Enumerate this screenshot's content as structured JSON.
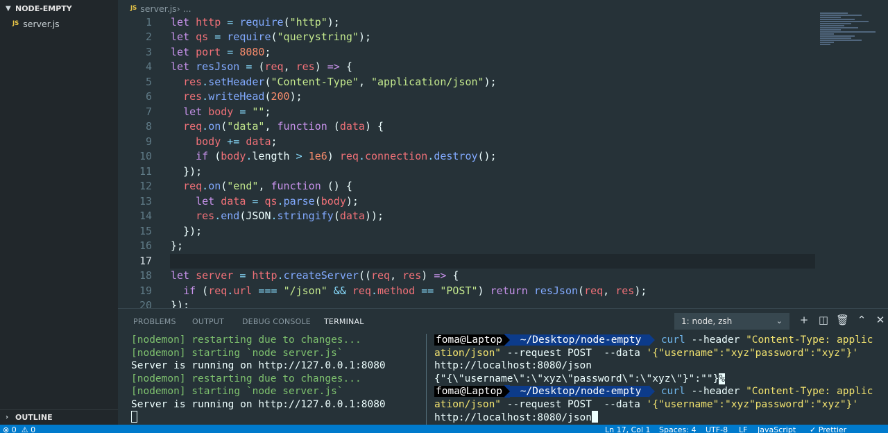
{
  "sidebar": {
    "explorer_title": "NODE-EMPTY",
    "file_badge": "JS",
    "file_name": "server.js",
    "outline_title": "OUTLINE"
  },
  "editor": {
    "breadcrumb_badge": "JS",
    "breadcrumb_file": "server.js",
    "breadcrumb_rest": " › ...",
    "current_line": 17,
    "lines": [
      {
        "n": "1",
        "tokens": [
          [
            "kw",
            "let "
          ],
          [
            "vr",
            "http"
          ],
          [
            "op",
            " = "
          ],
          [
            "fn",
            "require"
          ],
          [
            "pl",
            "("
          ],
          [
            "str",
            "\"http\""
          ],
          [
            "pl",
            ");"
          ]
        ]
      },
      {
        "n": "2",
        "tokens": [
          [
            "kw",
            "let "
          ],
          [
            "vr",
            "qs"
          ],
          [
            "op",
            " = "
          ],
          [
            "fn",
            "require"
          ],
          [
            "pl",
            "("
          ],
          [
            "str",
            "\"querystring\""
          ],
          [
            "pl",
            ");"
          ]
        ]
      },
      {
        "n": "3",
        "tokens": [
          [
            "kw",
            "let "
          ],
          [
            "vr",
            "port"
          ],
          [
            "op",
            " = "
          ],
          [
            "num",
            "8080"
          ],
          [
            "pl",
            ";"
          ]
        ]
      },
      {
        "n": "4",
        "tokens": [
          [
            "kw",
            "let "
          ],
          [
            "fn",
            "resJson"
          ],
          [
            "op",
            " = "
          ],
          [
            "pl",
            "("
          ],
          [
            "vr",
            "req"
          ],
          [
            "pl",
            ", "
          ],
          [
            "vr",
            "res"
          ],
          [
            "pl",
            ") "
          ],
          [
            "kw",
            "=>"
          ],
          [
            "pl",
            " {"
          ]
        ]
      },
      {
        "n": "5",
        "tokens": [
          [
            "pl",
            "  "
          ],
          [
            "vr",
            "res"
          ],
          [
            "op",
            "."
          ],
          [
            "fn",
            "setHeader"
          ],
          [
            "pl",
            "("
          ],
          [
            "str",
            "\"Content-Type\""
          ],
          [
            "pl",
            ", "
          ],
          [
            "str",
            "\"application/json\""
          ],
          [
            "pl",
            ");"
          ]
        ]
      },
      {
        "n": "6",
        "tokens": [
          [
            "pl",
            "  "
          ],
          [
            "vr",
            "res"
          ],
          [
            "op",
            "."
          ],
          [
            "fn",
            "writeHead"
          ],
          [
            "pl",
            "("
          ],
          [
            "num",
            "200"
          ],
          [
            "pl",
            ");"
          ]
        ]
      },
      {
        "n": "7",
        "tokens": [
          [
            "pl",
            "  "
          ],
          [
            "kw",
            "let "
          ],
          [
            "vr",
            "body"
          ],
          [
            "op",
            " = "
          ],
          [
            "str",
            "\"\""
          ],
          [
            "pl",
            ";"
          ]
        ]
      },
      {
        "n": "8",
        "tokens": [
          [
            "pl",
            "  "
          ],
          [
            "vr",
            "req"
          ],
          [
            "op",
            "."
          ],
          [
            "fn",
            "on"
          ],
          [
            "pl",
            "("
          ],
          [
            "str",
            "\"data\""
          ],
          [
            "pl",
            ", "
          ],
          [
            "kw",
            "function"
          ],
          [
            "pl",
            " ("
          ],
          [
            "vr",
            "data"
          ],
          [
            "pl",
            ") {"
          ]
        ]
      },
      {
        "n": "9",
        "tokens": [
          [
            "pl",
            "    "
          ],
          [
            "vr",
            "body"
          ],
          [
            "op",
            " += "
          ],
          [
            "vr",
            "data"
          ],
          [
            "pl",
            ";"
          ]
        ]
      },
      {
        "n": "10",
        "tokens": [
          [
            "pl",
            "    "
          ],
          [
            "kw",
            "if"
          ],
          [
            "pl",
            " ("
          ],
          [
            "vr",
            "body"
          ],
          [
            "op",
            "."
          ],
          [
            "pl",
            "length "
          ],
          [
            "op",
            ">"
          ],
          [
            "pl",
            " "
          ],
          [
            "num",
            "1e6"
          ],
          [
            "pl",
            ") "
          ],
          [
            "vr",
            "req"
          ],
          [
            "op",
            "."
          ],
          [
            "vr",
            "connection"
          ],
          [
            "op",
            "."
          ],
          [
            "fn",
            "destroy"
          ],
          [
            "pl",
            "();"
          ]
        ]
      },
      {
        "n": "11",
        "tokens": [
          [
            "pl",
            "  });"
          ]
        ]
      },
      {
        "n": "12",
        "tokens": [
          [
            "pl",
            "  "
          ],
          [
            "vr",
            "req"
          ],
          [
            "op",
            "."
          ],
          [
            "fn",
            "on"
          ],
          [
            "pl",
            "("
          ],
          [
            "str",
            "\"end\""
          ],
          [
            "pl",
            ", "
          ],
          [
            "kw",
            "function"
          ],
          [
            "pl",
            " () {"
          ]
        ]
      },
      {
        "n": "13",
        "tokens": [
          [
            "pl",
            "    "
          ],
          [
            "kw",
            "let "
          ],
          [
            "vr",
            "data"
          ],
          [
            "op",
            " = "
          ],
          [
            "vr",
            "qs"
          ],
          [
            "op",
            "."
          ],
          [
            "fn",
            "parse"
          ],
          [
            "pl",
            "("
          ],
          [
            "vr",
            "body"
          ],
          [
            "pl",
            ");"
          ]
        ]
      },
      {
        "n": "14",
        "tokens": [
          [
            "pl",
            "    "
          ],
          [
            "vr",
            "res"
          ],
          [
            "op",
            "."
          ],
          [
            "fn",
            "end"
          ],
          [
            "pl",
            "(JSON"
          ],
          [
            "op",
            "."
          ],
          [
            "fn",
            "stringify"
          ],
          [
            "pl",
            "("
          ],
          [
            "vr",
            "data"
          ],
          [
            "pl",
            "));"
          ]
        ]
      },
      {
        "n": "15",
        "tokens": [
          [
            "pl",
            "  });"
          ]
        ]
      },
      {
        "n": "16",
        "tokens": [
          [
            "pl",
            "};"
          ]
        ]
      },
      {
        "n": "17",
        "tokens": []
      },
      {
        "n": "18",
        "tokens": [
          [
            "kw",
            "let "
          ],
          [
            "vr",
            "server"
          ],
          [
            "op",
            " = "
          ],
          [
            "vr",
            "http"
          ],
          [
            "op",
            "."
          ],
          [
            "fn",
            "createServer"
          ],
          [
            "pl",
            "(("
          ],
          [
            "vr",
            "req"
          ],
          [
            "pl",
            ", "
          ],
          [
            "vr",
            "res"
          ],
          [
            "pl",
            ") "
          ],
          [
            "kw",
            "=>"
          ],
          [
            "pl",
            " {"
          ]
        ]
      },
      {
        "n": "19",
        "tokens": [
          [
            "pl",
            "  "
          ],
          [
            "kw",
            "if"
          ],
          [
            "pl",
            " ("
          ],
          [
            "vr",
            "req"
          ],
          [
            "op",
            "."
          ],
          [
            "vr",
            "url"
          ],
          [
            "op",
            " === "
          ],
          [
            "str",
            "\"/json\""
          ],
          [
            "op",
            " && "
          ],
          [
            "vr",
            "req"
          ],
          [
            "op",
            "."
          ],
          [
            "vr",
            "method"
          ],
          [
            "op",
            " == "
          ],
          [
            "str",
            "\"POST\""
          ],
          [
            "pl",
            ") "
          ],
          [
            "kw",
            "return "
          ],
          [
            "fn",
            "resJson"
          ],
          [
            "pl",
            "("
          ],
          [
            "vr",
            "req"
          ],
          [
            "pl",
            ", "
          ],
          [
            "vr",
            "res"
          ],
          [
            "pl",
            ");"
          ]
        ]
      },
      {
        "n": "20",
        "tokens": [
          [
            "pl",
            "});"
          ]
        ]
      }
    ]
  },
  "panel": {
    "tabs": [
      "PROBLEMS",
      "OUTPUT",
      "DEBUG CONSOLE",
      "TERMINAL"
    ],
    "active_tab": "TERMINAL",
    "terminal_select": "1: node, zsh"
  },
  "terminal_left": [
    {
      "cls": "t-green",
      "text": "[nodemon] restarting due to changes..."
    },
    {
      "cls": "t-green",
      "text": "[nodemon] starting `node server.js`"
    },
    {
      "cls": "t-white",
      "text": "Server is running on http://127.0.0.1:8080"
    },
    {
      "cls": "t-green",
      "text": "[nodemon] restarting due to changes..."
    },
    {
      "cls": "t-green",
      "text": "[nodemon] starting `node server.js`"
    },
    {
      "cls": "t-white",
      "text": "Server is running on http://127.0.0.1:8080"
    }
  ],
  "terminal_right": {
    "prompt_user": "foma@Laptop",
    "prompt_path": " ~/Desktop/node-empty ",
    "cmd_name": "curl",
    "cmd_flag1": " --header ",
    "cmd_arg1_a": "\"Content-Type: applic",
    "cmd_arg1_b": "ation/json\"",
    "cmd_flag2": " --request POST  --data ",
    "cmd_arg2": "'{\"username\":\"xyz\"password\":\"xyz\"}'",
    "url": "http://localhost:8080/json",
    "response": "{\"{\\\"username\\\":\\\"xyz\\\"password\\\":\\\"xyz\\\"}\":\"\"}",
    "response_marker": "%"
  },
  "statusbar": {
    "left": "⊗ 0  ⚠ 0",
    "cursor_pos": "Ln 17, Col 1",
    "spaces": "Spaces: 4",
    "encoding": "UTF-8",
    "eol": "LF",
    "language": "JavaScript",
    "formatter": "✓ Prettier"
  },
  "colors": {
    "editor_bg": "#263238",
    "sidebar_bg": "#21272b",
    "status_bg": "#007acc",
    "prompt_path_bg": "#0c3b8a"
  }
}
